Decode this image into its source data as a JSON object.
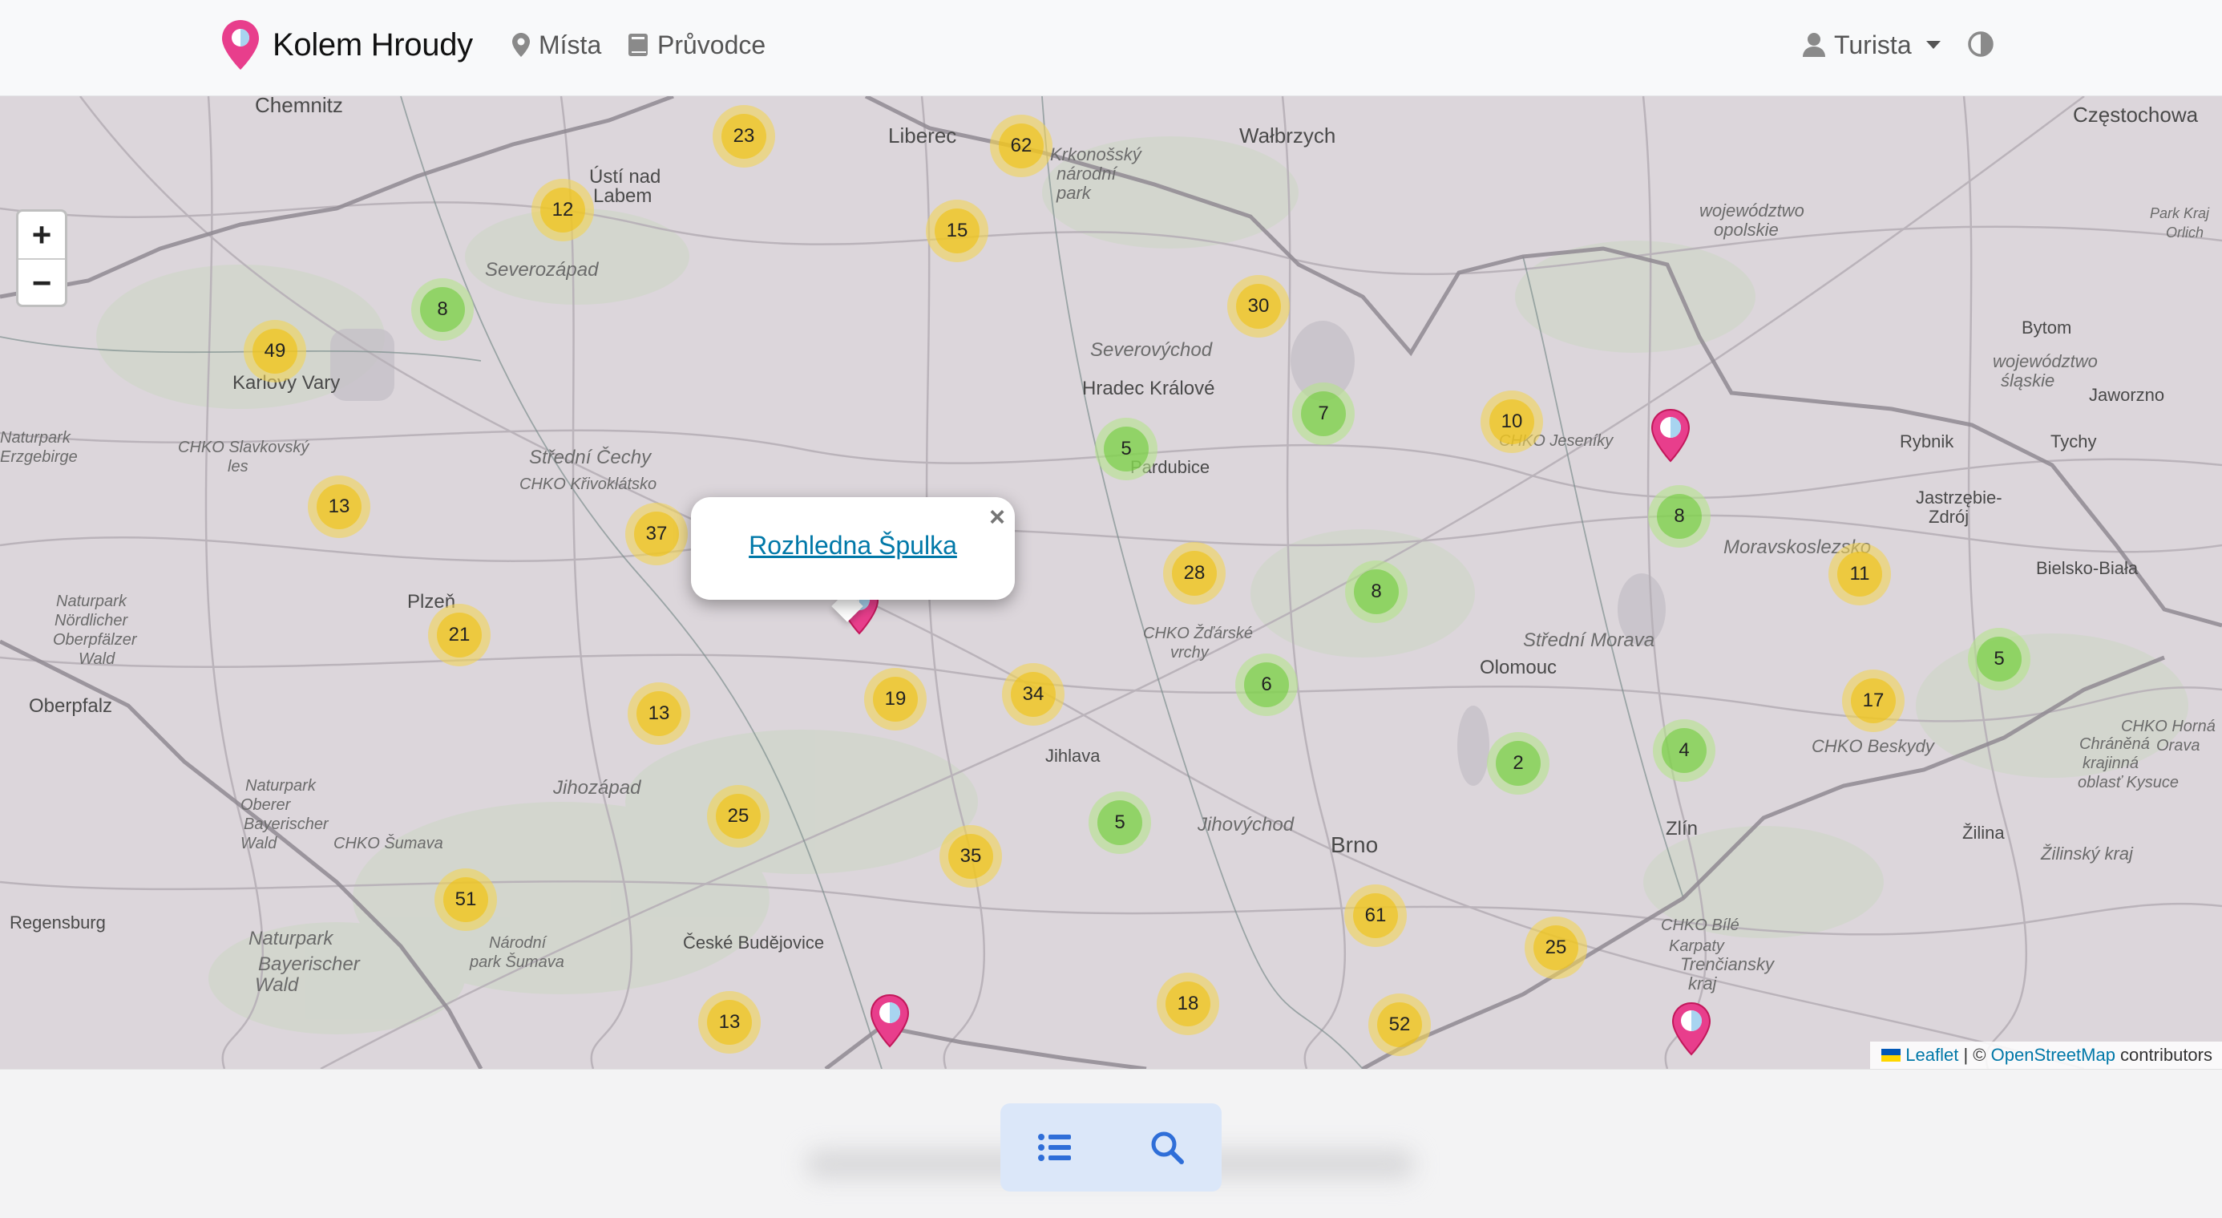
{
  "navbar": {
    "brand": "Kolem Hroudy",
    "nav": [
      {
        "label": "Místa",
        "icon": "map-pin-icon"
      },
      {
        "label": "Průvodce",
        "icon": "book-icon"
      }
    ],
    "user": {
      "label": "Turista",
      "icon": "user-icon"
    },
    "theme_icon": "contrast-icon"
  },
  "map": {
    "zoom_in_label": "+",
    "zoom_out_label": "−",
    "labels": [
      {
        "text": "Chemnitz"
      },
      {
        "text": "Liberec"
      },
      {
        "text": "Wałbrzych"
      },
      {
        "text": "Częstochowa"
      },
      {
        "text": "Ústí nad"
      },
      {
        "text": "Labem"
      },
      {
        "text": "Krkonošský"
      },
      {
        "text": "národní"
      },
      {
        "text": "park"
      },
      {
        "text": "Severozápad"
      },
      {
        "text": "województwo"
      },
      {
        "text": "opolskie"
      },
      {
        "text": "Karlovy Vary"
      },
      {
        "text": "Severovýchod"
      },
      {
        "text": "Hradec Králové"
      },
      {
        "text": "Bytom"
      },
      {
        "text": "województwo"
      },
      {
        "text": "śląskie"
      },
      {
        "text": "Jaworzno"
      },
      {
        "text": "Tychy"
      },
      {
        "text": "Rybnik"
      },
      {
        "text": "Jastrzębie-"
      },
      {
        "text": "Zdrój"
      },
      {
        "text": "CHKO Slavkovský"
      },
      {
        "text": "les"
      },
      {
        "text": "Střední Čechy"
      },
      {
        "text": "CHKO Křivoklátsko"
      },
      {
        "text": "Pardubice"
      },
      {
        "text": "CHKO Jeseníky"
      },
      {
        "text": "Moravskoslezsko"
      },
      {
        "text": "Bielsko-Biała"
      },
      {
        "text": "Plzeň"
      },
      {
        "text": "Naturpark"
      },
      {
        "text": "Nördlicher"
      },
      {
        "text": "Oberpfälzer"
      },
      {
        "text": "Wald"
      },
      {
        "text": "CHKO Žďárské"
      },
      {
        "text": "vrchy"
      },
      {
        "text": "Střední Morava"
      },
      {
        "text": "Olomouc"
      },
      {
        "text": "Oberpfalz"
      },
      {
        "text": "Jihozápad"
      },
      {
        "text": "Jihlava"
      },
      {
        "text": "CHKO Beskydy"
      },
      {
        "text": "Chráněná"
      },
      {
        "text": "krajinná"
      },
      {
        "text": "oblasť Kysuce"
      },
      {
        "text": "CHKO Horná"
      },
      {
        "text": "Orava"
      },
      {
        "text": "Naturpark"
      },
      {
        "text": "Oberer"
      },
      {
        "text": "Bayerischer"
      },
      {
        "text": "Wald"
      },
      {
        "text": "CHKO Šumava"
      },
      {
        "text": "Jihovýchod"
      },
      {
        "text": "Zlín"
      },
      {
        "text": "Brno"
      },
      {
        "text": "Žilina"
      },
      {
        "text": "Žilinský kraj"
      },
      {
        "text": "Regensburg"
      },
      {
        "text": "Naturpark"
      },
      {
        "text": "Bayerischer"
      },
      {
        "text": "Wald"
      },
      {
        "text": "Národní"
      },
      {
        "text": "park Šumava"
      },
      {
        "text": "České Budějovice"
      },
      {
        "text": "CHKO Bílé"
      },
      {
        "text": "Karpaty"
      },
      {
        "text": "Trenčiansky"
      },
      {
        "text": "kraj"
      },
      {
        "text": "Park Kraj"
      },
      {
        "text": "Orlich"
      },
      {
        "text": "Naturpark"
      },
      {
        "text": "Erzgebirge"
      }
    ],
    "clusters": [
      {
        "count": "23",
        "color": "yellow"
      },
      {
        "count": "62",
        "color": "yellow"
      },
      {
        "count": "12",
        "color": "yellow"
      },
      {
        "count": "15",
        "color": "yellow"
      },
      {
        "count": "8",
        "color": "green"
      },
      {
        "count": "30",
        "color": "yellow"
      },
      {
        "count": "49",
        "color": "yellow"
      },
      {
        "count": "7",
        "color": "green"
      },
      {
        "count": "10",
        "color": "yellow"
      },
      {
        "count": "5",
        "color": "green"
      },
      {
        "count": "13",
        "color": "yellow"
      },
      {
        "count": "37",
        "color": "yellow"
      },
      {
        "count": "8",
        "color": "green"
      },
      {
        "count": "21",
        "color": "yellow"
      },
      {
        "count": "28",
        "color": "yellow"
      },
      {
        "count": "11",
        "color": "yellow"
      },
      {
        "count": "8",
        "color": "green"
      },
      {
        "count": "6",
        "color": "green"
      },
      {
        "count": "5",
        "color": "green"
      },
      {
        "count": "13",
        "color": "yellow"
      },
      {
        "count": "19",
        "color": "yellow"
      },
      {
        "count": "34",
        "color": "yellow"
      },
      {
        "count": "17",
        "color": "yellow"
      },
      {
        "count": "2",
        "color": "green"
      },
      {
        "count": "4",
        "color": "green"
      },
      {
        "count": "25",
        "color": "yellow"
      },
      {
        "count": "5",
        "color": "green"
      },
      {
        "count": "35",
        "color": "yellow"
      },
      {
        "count": "51",
        "color": "yellow"
      },
      {
        "count": "61",
        "color": "yellow"
      },
      {
        "count": "25",
        "color": "yellow"
      },
      {
        "count": "18",
        "color": "yellow"
      },
      {
        "count": "13",
        "color": "yellow"
      },
      {
        "count": "52",
        "color": "yellow"
      }
    ],
    "popup": {
      "title": "Rozhledna Špulka",
      "close": "×"
    },
    "attribution": {
      "leaflet": "Leaflet",
      "separator": " | © ",
      "osm": "OpenStreetMap",
      "suffix": " contributors"
    }
  },
  "bottom": {
    "buttons": [
      {
        "icon": "list-icon"
      },
      {
        "icon": "search-icon"
      }
    ]
  },
  "colors": {
    "accent": "#e83e8c",
    "link": "#0078a8",
    "cluster_yellow": "#f0c20c",
    "cluster_green": "#6ecc39"
  }
}
